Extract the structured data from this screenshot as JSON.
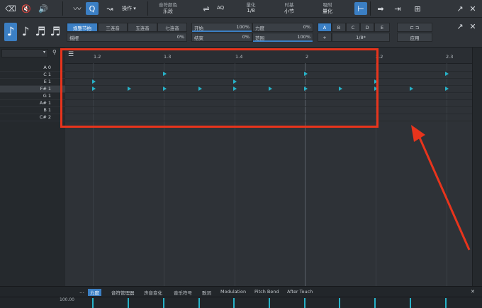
{
  "toolbar": {
    "icons": [
      "eraser-icon",
      "mute-icon",
      "speaker-icon",
      "waveform-icon",
      "quantize-icon",
      "bend-icon"
    ],
    "action_label": "操作",
    "color_label": "音符颜色",
    "color_value": "乐段",
    "aq_label": "AQ",
    "quantize_label": "量化",
    "quantize_value": "1/8",
    "timebase_label": "时基",
    "timebase_value": "小节",
    "snap_label": "吸附",
    "snap_value": "量化"
  },
  "quantize_panel": {
    "types": [
      "规整节拍",
      "三连音",
      "五连音",
      "七连音"
    ],
    "swing_label": "摇摆",
    "swing_value": "0%",
    "start_label": "开始",
    "start_value": "100%",
    "end_label": "结束",
    "end_value": "0%",
    "strength_label": "力度",
    "strength_value": "0%",
    "range_label": "范围",
    "range_value": "100%",
    "presets": [
      "A",
      "B",
      "C",
      "D",
      "E"
    ],
    "add_label": "+",
    "grid_value": "1/8*",
    "apply_label": "应用"
  },
  "piano_keys": [
    "A 0",
    "C 1",
    "E 1",
    "F# 1",
    "G 1",
    "A# 1",
    "B 1",
    "C# 2"
  ],
  "ruler_ticks": [
    "1.2",
    "1.3",
    "1.4",
    "2",
    "2.2",
    "2.3"
  ],
  "controller_tabs": [
    "力度",
    "音符管理器",
    "声音变化",
    "音乐符号",
    "歌词",
    "Modulation",
    "Pitch Bend",
    "After Touch"
  ],
  "controller_value": "100.00",
  "colors": {
    "accent": "#3b7fc4",
    "note": "#27b3c9",
    "highlight": "#e8341c"
  }
}
